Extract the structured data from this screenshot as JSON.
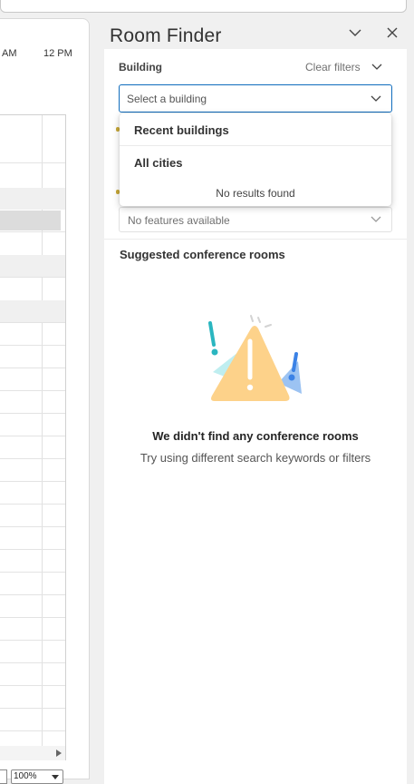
{
  "calendar": {
    "time_labels": [
      "AM",
      "12 PM"
    ],
    "zoom": "100%"
  },
  "room_finder": {
    "title": "Room Finder",
    "building_label": "Building",
    "clear_filters": "Clear filters",
    "building_placeholder": "Select a building",
    "features_placeholder": "No features available",
    "dropdown": {
      "items": [
        "Recent buildings",
        "All cities"
      ],
      "empty": "No results found"
    },
    "suggested_title": "Suggested conference rooms",
    "empty_title": "We didn't find any conference rooms",
    "empty_subtitle": "Try using different search keywords or filters"
  },
  "colors": {
    "accent": "#0f6cbd",
    "warning_fill": "#fdd28a",
    "teal": "#2bb6c0",
    "blue": "#3b82e6"
  }
}
